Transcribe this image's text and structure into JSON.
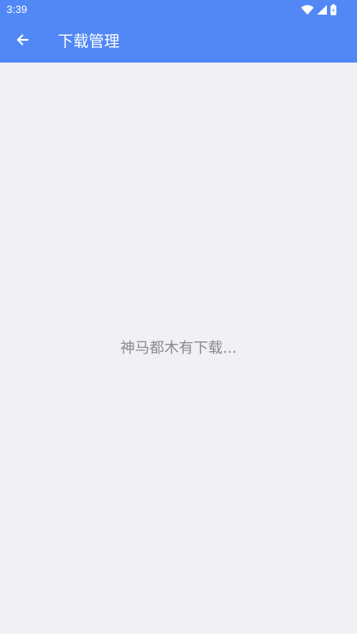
{
  "status_bar": {
    "time": "3:39",
    "icons": [
      "wifi-icon",
      "signal-icon",
      "battery-icon"
    ]
  },
  "app_bar": {
    "title": "下载管理",
    "back_icon": "arrow-left-icon"
  },
  "content": {
    "empty_message": "神马都木有下载..."
  },
  "colors": {
    "primary": "#5188f6",
    "background": "#f0f0f5",
    "empty_text": "#8b8b8b",
    "on_primary": "#ffffff"
  }
}
